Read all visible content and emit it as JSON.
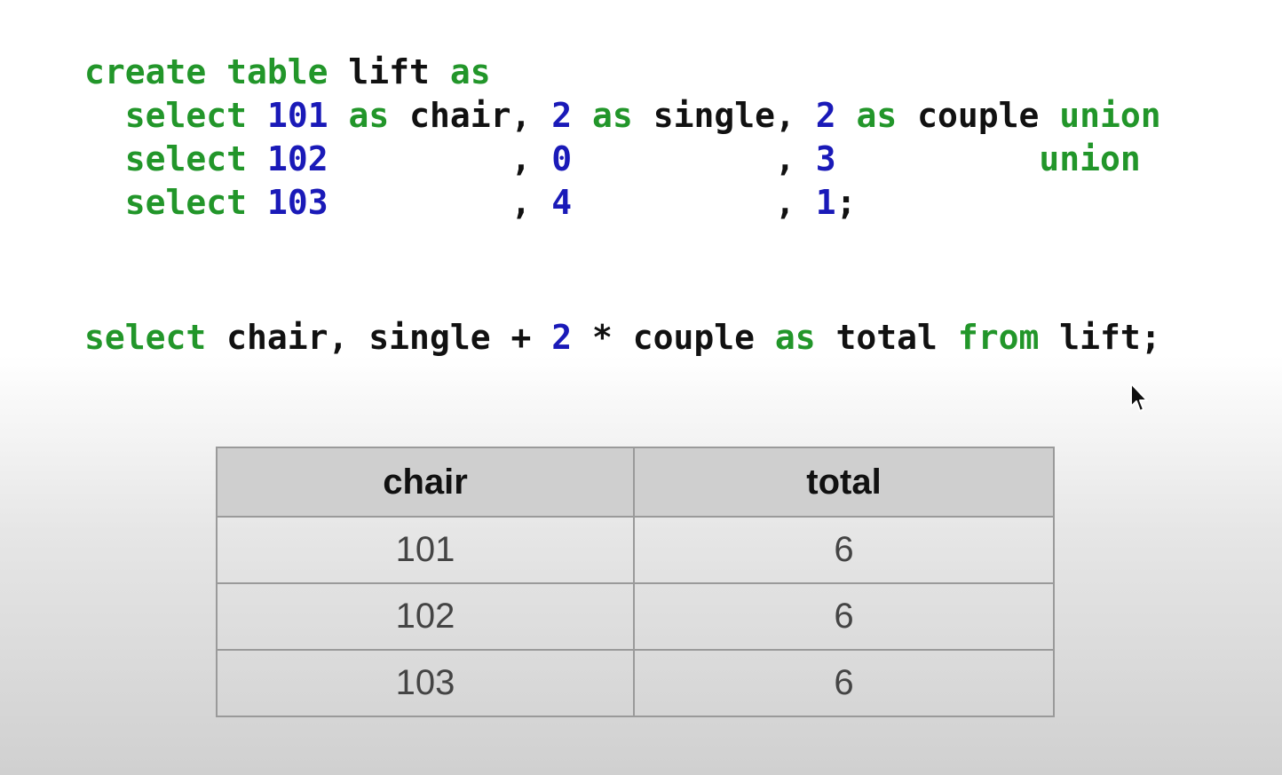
{
  "code_block_1": {
    "line_1": [
      {
        "text": "create table",
        "role": "kw"
      },
      {
        "text": " lift ",
        "role": "ident"
      },
      {
        "text": "as",
        "role": "kw"
      }
    ],
    "line_2": [
      {
        "text": "  ",
        "role": "ident"
      },
      {
        "text": "select",
        "role": "kw"
      },
      {
        "text": " ",
        "role": "ident"
      },
      {
        "text": "101",
        "role": "num"
      },
      {
        "text": " ",
        "role": "ident"
      },
      {
        "text": "as",
        "role": "kw"
      },
      {
        "text": " chair, ",
        "role": "ident"
      },
      {
        "text": "2",
        "role": "num"
      },
      {
        "text": " ",
        "role": "ident"
      },
      {
        "text": "as",
        "role": "kw"
      },
      {
        "text": " single, ",
        "role": "ident"
      },
      {
        "text": "2",
        "role": "num"
      },
      {
        "text": " ",
        "role": "ident"
      },
      {
        "text": "as",
        "role": "kw"
      },
      {
        "text": " couple ",
        "role": "ident"
      },
      {
        "text": "union",
        "role": "kw"
      }
    ],
    "line_3": [
      {
        "text": "  ",
        "role": "ident"
      },
      {
        "text": "select",
        "role": "kw"
      },
      {
        "text": " ",
        "role": "ident"
      },
      {
        "text": "102",
        "role": "num"
      },
      {
        "text": "         , ",
        "role": "ident"
      },
      {
        "text": "0",
        "role": "num"
      },
      {
        "text": "          , ",
        "role": "ident"
      },
      {
        "text": "3",
        "role": "num"
      },
      {
        "text": "          ",
        "role": "ident"
      },
      {
        "text": "union",
        "role": "kw"
      }
    ],
    "line_4": [
      {
        "text": "  ",
        "role": "ident"
      },
      {
        "text": "select",
        "role": "kw"
      },
      {
        "text": " ",
        "role": "ident"
      },
      {
        "text": "103",
        "role": "num"
      },
      {
        "text": "         , ",
        "role": "ident"
      },
      {
        "text": "4",
        "role": "num"
      },
      {
        "text": "          , ",
        "role": "ident"
      },
      {
        "text": "1",
        "role": "num"
      },
      {
        "text": ";",
        "role": "ident"
      }
    ]
  },
  "code_block_2": {
    "line_1": [
      {
        "text": "select",
        "role": "kw"
      },
      {
        "text": " chair, single + ",
        "role": "ident"
      },
      {
        "text": "2",
        "role": "num"
      },
      {
        "text": " * couple ",
        "role": "ident"
      },
      {
        "text": "as",
        "role": "kw"
      },
      {
        "text": " total ",
        "role": "ident"
      },
      {
        "text": "from",
        "role": "kw"
      },
      {
        "text": " lift;",
        "role": "ident"
      }
    ]
  },
  "result_table": {
    "headers": {
      "chair": "chair",
      "total": "total"
    },
    "rows": [
      {
        "chair": "101",
        "total": "6"
      },
      {
        "chair": "102",
        "total": "6"
      },
      {
        "chair": "103",
        "total": "6"
      }
    ]
  },
  "colors": {
    "keyword": "#22962a",
    "number": "#1a1ab8",
    "identifier": "#111111",
    "table_header_bg": "#cfcfcf",
    "table_border": "#9a9a9a"
  },
  "icons": {
    "cursor": "mouse-pointer-icon"
  }
}
